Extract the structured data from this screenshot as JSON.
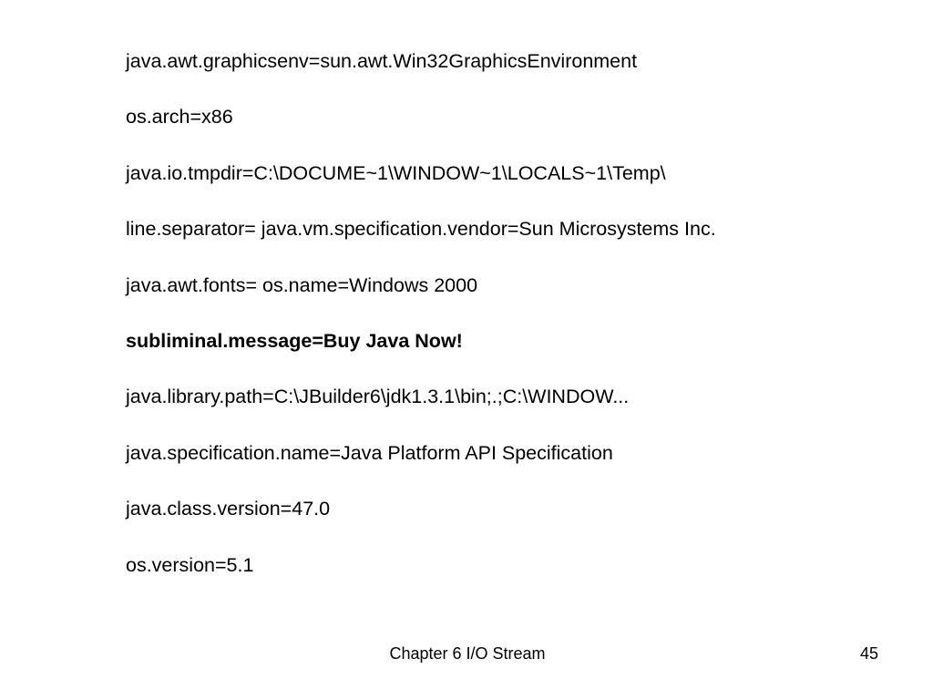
{
  "slide": {
    "lines": [
      {
        "text": "java.awt.graphicsenv=sun.awt.Win32GraphicsEnvironment",
        "bold": false
      },
      {
        "text": "os.arch=x86",
        "bold": false
      },
      {
        "text": "java.io.tmpdir=C:\\DOCUME~1\\WINDOW~1\\LOCALS~1\\Temp\\",
        "bold": false
      },
      {
        "text": "line.separator= java.vm.specification.vendor=Sun Microsystems Inc.",
        "bold": false
      },
      {
        "text": "java.awt.fonts= os.name=Windows 2000",
        "bold": false
      },
      {
        "text": "subliminal.message=Buy Java Now!",
        "bold": true
      },
      {
        "text": "java.library.path=C:\\JBuilder6\\jdk1.3.1\\bin;.;C:\\WINDOW...",
        "bold": false
      },
      {
        "text": "java.specification.name=Java Platform API Specification",
        "bold": false
      },
      {
        "text": "java.class.version=47.0",
        "bold": false
      },
      {
        "text": "os.version=5.1",
        "bold": false
      }
    ]
  },
  "footer": {
    "title": "Chapter 6 I/O Stream",
    "page_number": "45"
  },
  "colors": {
    "background": "#ffffff",
    "text": "#000000"
  }
}
